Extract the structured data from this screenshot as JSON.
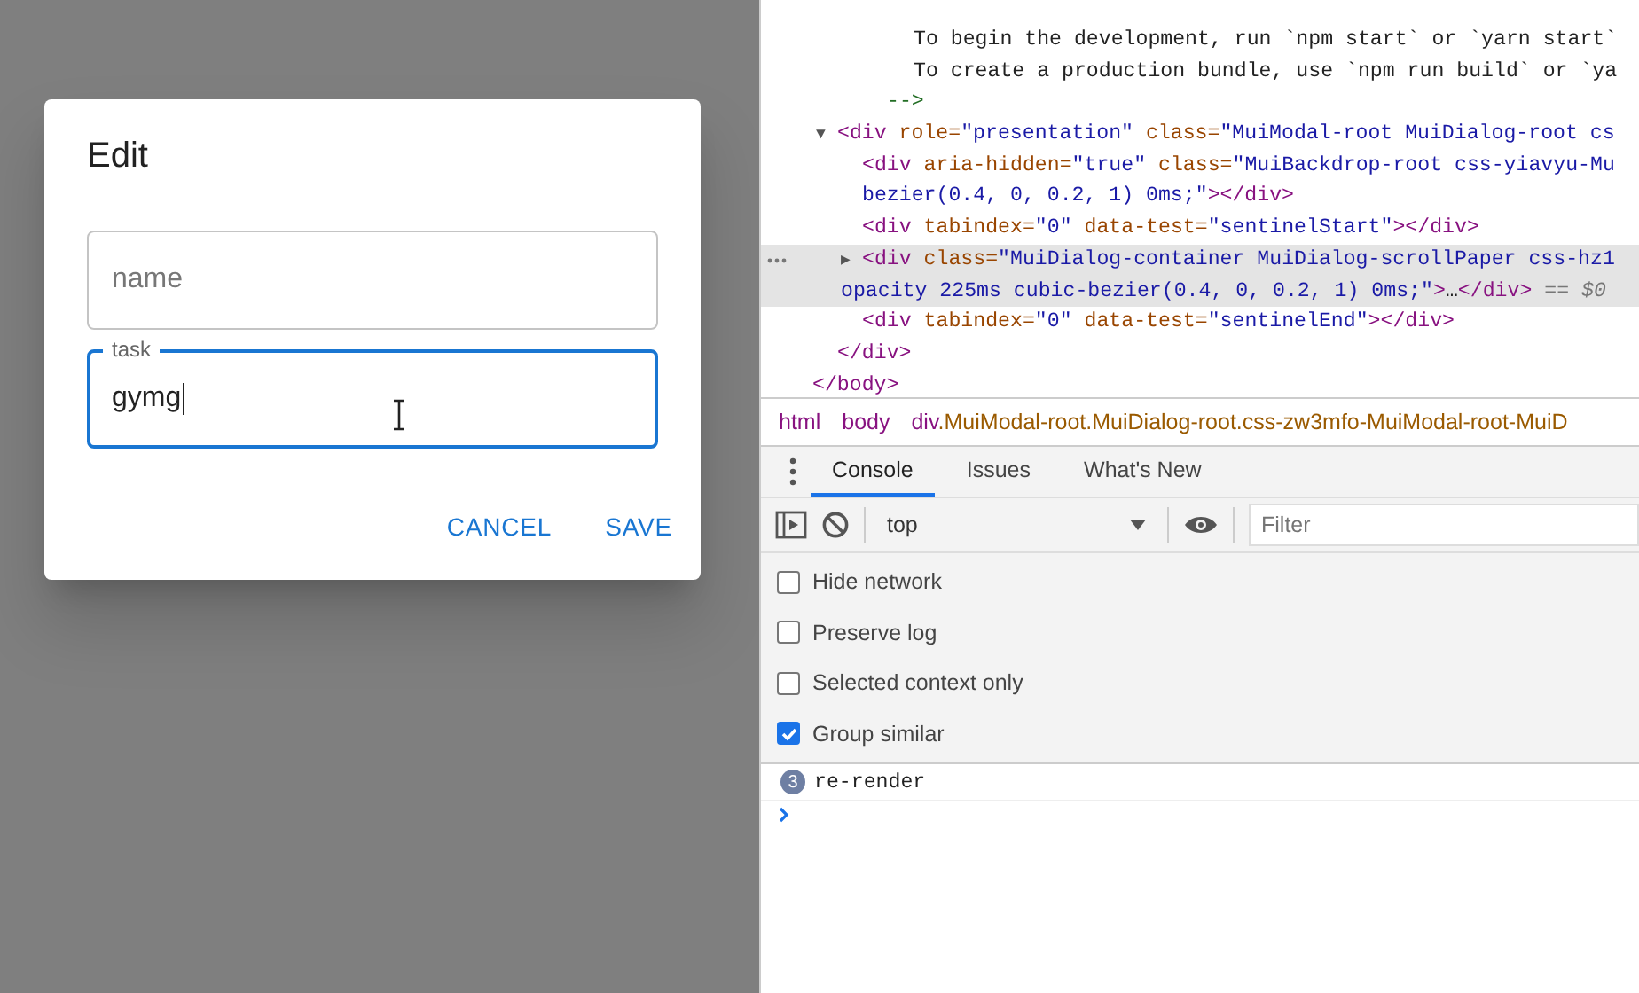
{
  "dialog": {
    "title": "Edit",
    "fields": [
      {
        "label": "name",
        "focused": false
      },
      {
        "label": "task",
        "value": "gymg",
        "focused": true
      }
    ],
    "buttons": [
      "CANCEL",
      "SAVE"
    ]
  },
  "devtools": {
    "dom_nodes": [
      {
        "kind": "comment",
        "lines": [
          "To begin the development, run `npm start` or `yarn start`",
          "To create a production bundle, use `npm run build` or `ya"
        ],
        "end": "-->"
      },
      {
        "kind": "element",
        "toggle": "▼",
        "selected": false,
        "lines": [
          [
            {
              "kind": "tag",
              "text": "<div"
            },
            {
              "kind": "attr",
              "text": " role="
            },
            {
              "kind": "value",
              "text": "\"presentation\""
            },
            {
              "kind": "attr",
              "text": " class="
            },
            {
              "kind": "value",
              "text": "\"MuiModal-root MuiDialog-root cs"
            }
          ]
        ],
        "children": [
          {
            "kind": "element",
            "selected": false,
            "lines": [
              [
                {
                  "kind": "tag",
                  "text": "<div"
                },
                {
                  "kind": "attr",
                  "text": " aria-hidden="
                },
                {
                  "kind": "value",
                  "text": "\"true\""
                },
                {
                  "kind": "attr",
                  "text": " class="
                },
                {
                  "kind": "value",
                  "text": "\"MuiBackdrop-root css-yiavyu-Mu"
                }
              ],
              [
                {
                  "kind": "value",
                  "text": "bezier(0.4, 0, 0.2, 1) 0ms;\""
                },
                {
                  "kind": "tag",
                  "text": "></div>"
                }
              ]
            ]
          },
          {
            "kind": "element",
            "selected": false,
            "lines": [
              [
                {
                  "kind": "tag",
                  "text": "<div"
                },
                {
                  "kind": "attr",
                  "text": " tabindex="
                },
                {
                  "kind": "value",
                  "text": "\"0\""
                },
                {
                  "kind": "attr",
                  "text": " data-test="
                },
                {
                  "kind": "value",
                  "text": "\"sentinelStart\""
                },
                {
                  "kind": "tag",
                  "text": "></div>"
                }
              ]
            ]
          },
          {
            "kind": "element",
            "toggle": "▶",
            "selected": true,
            "lines": [
              [
                {
                  "kind": "tag",
                  "text": "<div"
                },
                {
                  "kind": "attr",
                  "text": " class="
                },
                {
                  "kind": "value",
                  "text": "\"MuiDialog-container MuiDialog-scrollPaper css-hz1"
                }
              ],
              [
                {
                  "kind": "value",
                  "text": "opacity 225ms cubic-bezier(0.4, 0, 0.2, 1) 0ms;\""
                },
                {
                  "kind": "tag",
                  "text": ">"
                },
                {
                  "kind": "text",
                  "text": "…"
                },
                {
                  "kind": "tag",
                  "text": "</div>"
                },
                {
                  "kind": "ref",
                  "text": " == $0"
                }
              ]
            ]
          },
          {
            "kind": "element",
            "selected": false,
            "lines": [
              [
                {
                  "kind": "tag",
                  "text": "<div"
                },
                {
                  "kind": "attr",
                  "text": " tabindex="
                },
                {
                  "kind": "value",
                  "text": "\"0\""
                },
                {
                  "kind": "attr",
                  "text": " data-test="
                },
                {
                  "kind": "value",
                  "text": "\"sentinelEnd\""
                },
                {
                  "kind": "tag",
                  "text": "></div>"
                }
              ]
            ]
          }
        ],
        "closing": "</div>"
      },
      {
        "kind": "end_tag",
        "text": "</body>"
      }
    ],
    "breadcrumbs": [
      {
        "tag": "html"
      },
      {
        "tag": "body"
      },
      {
        "tag": "div",
        "classes": ".MuiModal-root.MuiDialog-root.css-zw3mfo-MuiModal-root-MuiD"
      }
    ],
    "drawer_tabs": [
      {
        "label": "Console",
        "selected": true
      },
      {
        "label": "Issues",
        "selected": false
      },
      {
        "label": "What's New",
        "selected": false
      }
    ],
    "toolbar": {
      "context": "top",
      "filter_placeholder": "Filter"
    },
    "settings": [
      {
        "label": "Hide network",
        "checked": false
      },
      {
        "label": "Preserve log",
        "checked": false
      },
      {
        "label": "Selected context only",
        "checked": false
      },
      {
        "label": "Group similar",
        "checked": true
      }
    ],
    "messages": [
      {
        "count": "3",
        "text": "re-render"
      }
    ]
  }
}
